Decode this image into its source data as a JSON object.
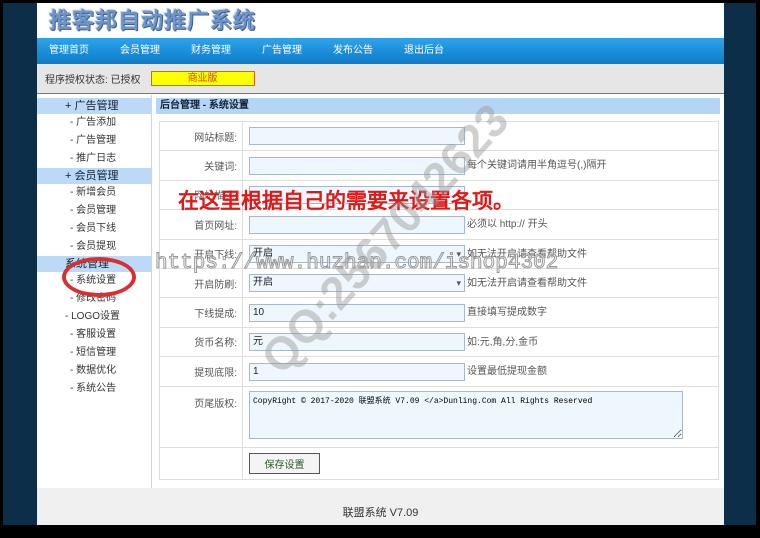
{
  "app": {
    "logo": "推客邦自动推广系统"
  },
  "nav": [
    "管理首页",
    "会员管理",
    "财务管理",
    "广告管理",
    "发布公告",
    "退出后台"
  ],
  "status": {
    "label": "程序授权状态: 已授权",
    "edition": "商业版"
  },
  "sidebar": {
    "groups": [
      {
        "title": "+ 广告管理",
        "items": [
          "- 广告添加",
          "- 广告管理",
          "- 推广日志"
        ]
      },
      {
        "title": "+ 会员管理",
        "items": [
          "- 新增会员",
          "- 会员管理",
          "- 会员下线",
          "- 会员提现"
        ]
      },
      {
        "title": "系统管理",
        "items": [
          "- 系统设置",
          "- 修改密码",
          "- LOGO设置",
          "- 客服设置",
          "- 短信管理",
          "- 数据优化",
          "- 系统公告"
        ]
      }
    ]
  },
  "main": {
    "title": "后台管理 - 系统设置",
    "fields": [
      {
        "label": "网站标题:",
        "value": "",
        "hint": ""
      },
      {
        "label": "关键词:",
        "value": "",
        "hint": "每个关键词请用半角逗号(,)隔开"
      },
      {
        "label": "网站描述:",
        "value": "",
        "hint": ""
      },
      {
        "label": "首页网址:",
        "value": "",
        "hint": "必须以 http:// 开头"
      },
      {
        "label": "开启下线:",
        "value": "开启",
        "hint": "如无法开启请查看帮助文件"
      },
      {
        "label": "开启防刷:",
        "value": "开启",
        "hint": "如无法开启请查看帮助文件"
      },
      {
        "label": "下线提成:",
        "value": "10",
        "hint": "直接填写提成数字"
      },
      {
        "label": "货币名称:",
        "value": "元",
        "hint": "如:元,角,分,金币"
      },
      {
        "label": "提现底限:",
        "value": "1",
        "hint": "设置最低提现金额"
      }
    ],
    "footer_label": "页尾版权:",
    "footer_value": "CopyRight © 2017-2020 联盟系统 V7.09 </a>Dunling.Com All Rights Reserved",
    "save": "保存设置"
  },
  "footer": "联盟系统 V7.09",
  "overlay": {
    "tip": "在这里根据自己的需要来设置各项。",
    "watermark_url": "https://www.huzhan.com/ishop4302",
    "watermark_qq": "QQ:2567042623"
  }
}
